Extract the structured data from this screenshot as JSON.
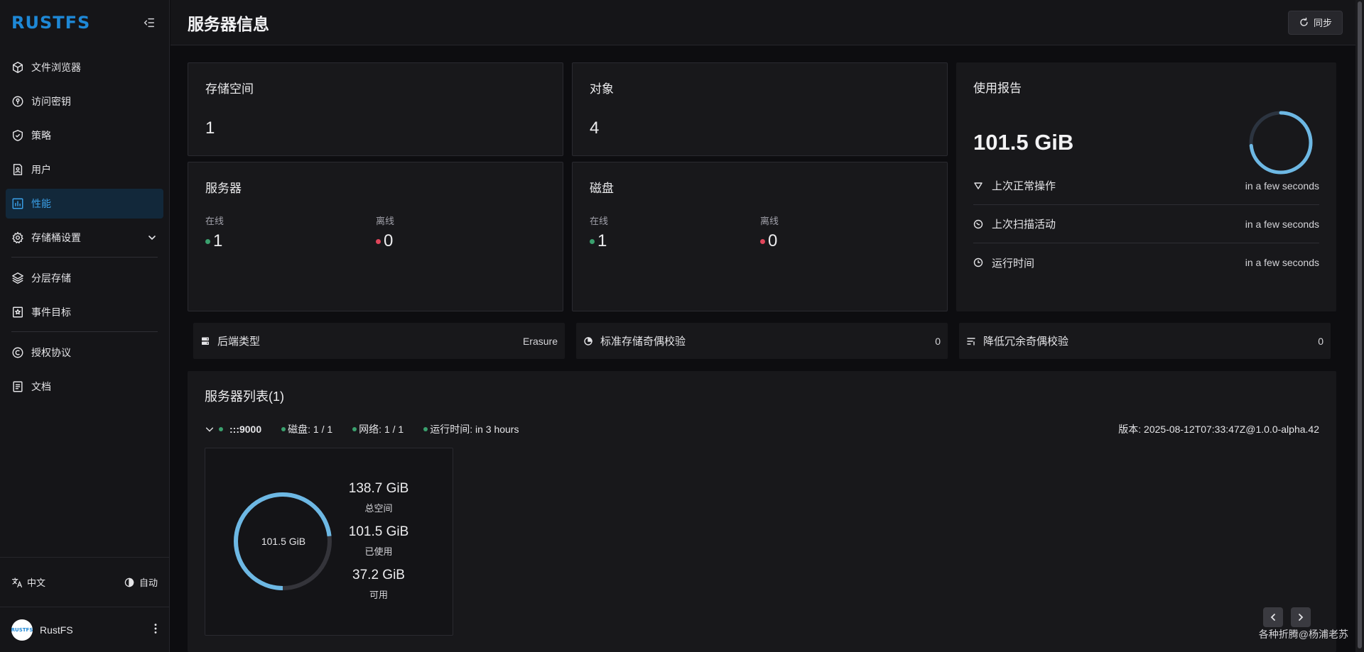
{
  "app": {
    "logo": "RUSTFS"
  },
  "sidebar": {
    "items": [
      {
        "label": "文件浏览器",
        "icon": "cube-icon"
      },
      {
        "label": "访问密钥",
        "icon": "key-circle-icon"
      },
      {
        "label": "策略",
        "icon": "shield-check-icon"
      },
      {
        "label": "用户",
        "icon": "user-file-icon"
      },
      {
        "label": "性能",
        "icon": "bar-chart-icon",
        "active": true
      },
      {
        "label": "存储桶设置",
        "icon": "gear-icon",
        "expandable": true
      },
      {
        "label": "分层存储",
        "icon": "layers-icon"
      },
      {
        "label": "事件目标",
        "icon": "bookmark-star-icon"
      },
      {
        "label": "授权协议",
        "icon": "copyright-icon"
      },
      {
        "label": "文档",
        "icon": "document-icon"
      }
    ],
    "language": "中文",
    "theme": "自动",
    "user": {
      "name": "RustFS",
      "avatar_text": "RUSTFS"
    }
  },
  "header": {
    "title": "服务器信息",
    "sync_label": "同步"
  },
  "cards": {
    "storage": {
      "title": "存储空间",
      "value": "1"
    },
    "objects": {
      "title": "对象",
      "value": "4"
    },
    "servers": {
      "title": "服务器",
      "online_label": "在线",
      "online": "1",
      "offline_label": "离线",
      "offline": "0"
    },
    "disks": {
      "title": "磁盘",
      "online_label": "在线",
      "online": "1",
      "offline_label": "离线",
      "offline": "0"
    }
  },
  "usage": {
    "title": "使用报告",
    "value": "101.5 GiB",
    "ring_fraction": 0.732,
    "rows": [
      {
        "label": "上次正常操作",
        "value": "in a few seconds",
        "icon": "triangle-down-icon"
      },
      {
        "label": "上次扫描活动",
        "value": "in a few seconds",
        "icon": "scan-clock-icon"
      },
      {
        "label": "运行时间",
        "value": "in a few seconds",
        "icon": "clock-icon"
      }
    ]
  },
  "strips": {
    "backend": {
      "label": "后端类型",
      "value": "Erasure"
    },
    "standard_parity": {
      "label": "标准存储奇偶校验",
      "value": "0"
    },
    "reduced_parity": {
      "label": "降低冗余奇偶校验",
      "value": "0"
    }
  },
  "server_list": {
    "title": "服务器列表(1)",
    "host": ":::9000",
    "disks": "磁盘: 1 / 1",
    "network": "网络: 1 / 1",
    "uptime": "运行时间: in 3 hours",
    "version": "版本: 2025-08-12T07:33:47Z@1.0.0-alpha.42",
    "disk": {
      "ring_label": "101.5 GiB",
      "used_fraction": 0.732,
      "total": "138.7 GiB",
      "total_label": "总空间",
      "used": "101.5 GiB",
      "used_label": "已使用",
      "free": "37.2 GiB",
      "free_label": "可用"
    }
  },
  "watermark": "各种折腾@杨浦老苏",
  "colors": {
    "accent": "#1e88d6",
    "ring": "#6db8e4",
    "online": "#3aa06e",
    "offline": "#e0455a"
  }
}
